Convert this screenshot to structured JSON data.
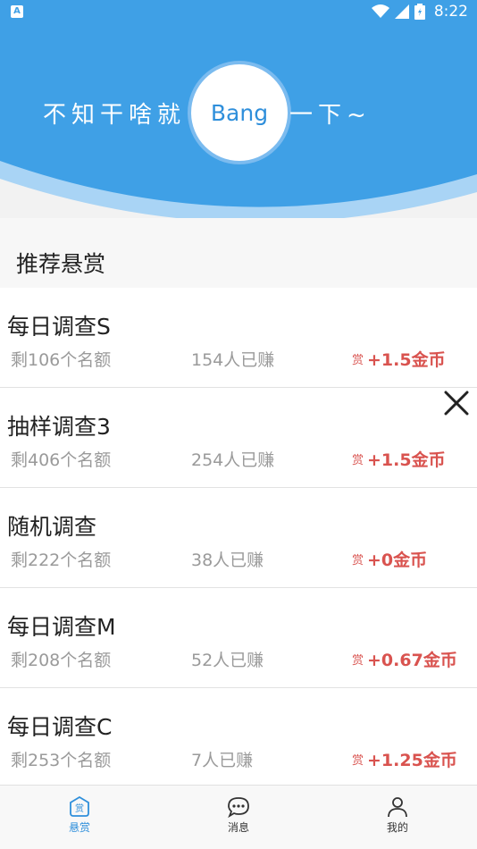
{
  "status_bar": {
    "time": "8:22",
    "app_notif": "A"
  },
  "header": {
    "slogan_left": "不知干啥就",
    "logo_text": "Bang",
    "slogan_right": "一下~"
  },
  "section": {
    "title": "推荐悬赏"
  },
  "tasks": [
    {
      "name": "每日调查S",
      "remaining": "剩106个名额",
      "earned": "154人已赚",
      "reward_label": "赏",
      "reward_value": "+1.5金币"
    },
    {
      "name": "抽样调查3",
      "remaining": "剩406个名额",
      "earned": "254人已赚",
      "reward_label": "赏",
      "reward_value": "+1.5金币"
    },
    {
      "name": "随机调查",
      "remaining": "剩222个名额",
      "earned": "38人已赚",
      "reward_label": "赏",
      "reward_value": "+0金币"
    },
    {
      "name": "每日调查M",
      "remaining": "剩208个名额",
      "earned": "52人已赚",
      "reward_label": "赏",
      "reward_value": "+0.67金币"
    },
    {
      "name": "每日调查C",
      "remaining": "剩253个名额",
      "earned": "7人已赚",
      "reward_label": "赏",
      "reward_value": "+1.25金币"
    }
  ],
  "bottom_nav": {
    "items": [
      {
        "label": "悬赏",
        "icon": "reward-icon",
        "icon_text": "赏",
        "active": true
      },
      {
        "label": "消息",
        "icon": "message-icon",
        "active": false
      },
      {
        "label": "我的",
        "icon": "profile-icon",
        "active": false
      }
    ]
  },
  "colors": {
    "primary": "#2f8fdb",
    "header_blue": "#3fa0e6",
    "reward_red": "#d9534f",
    "muted_text": "#9a9a9a"
  }
}
